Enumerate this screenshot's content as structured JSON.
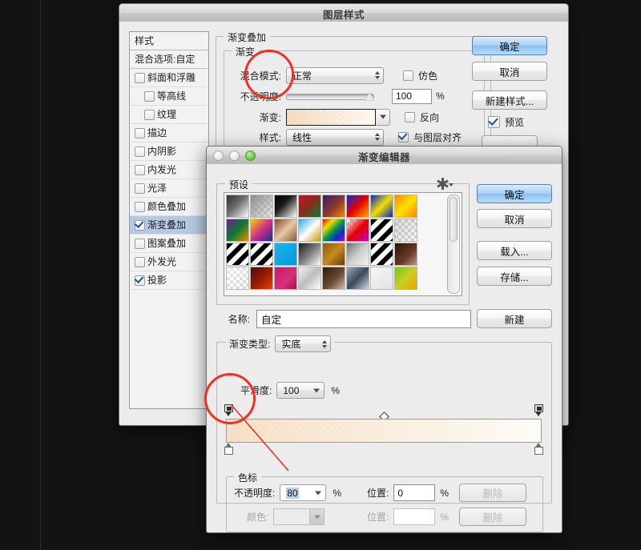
{
  "layer_style": {
    "title": "图层样式",
    "sidebar": {
      "header": "样式",
      "blending": "混合选项:自定",
      "items": [
        {
          "label": "斜面和浮雕",
          "checked": false,
          "sub": false,
          "selected": false
        },
        {
          "label": "等高线",
          "checked": false,
          "sub": true,
          "selected": false
        },
        {
          "label": "纹理",
          "checked": false,
          "sub": true,
          "selected": false
        },
        {
          "label": "描边",
          "checked": false,
          "sub": false,
          "selected": false
        },
        {
          "label": "内阴影",
          "checked": false,
          "sub": false,
          "selected": false
        },
        {
          "label": "内发光",
          "checked": false,
          "sub": false,
          "selected": false
        },
        {
          "label": "光泽",
          "checked": false,
          "sub": false,
          "selected": false
        },
        {
          "label": "颜色叠加",
          "checked": false,
          "sub": false,
          "selected": false
        },
        {
          "label": "渐变叠加",
          "checked": true,
          "sub": false,
          "selected": true
        },
        {
          "label": "图案叠加",
          "checked": false,
          "sub": false,
          "selected": false
        },
        {
          "label": "外发光",
          "checked": false,
          "sub": false,
          "selected": false
        },
        {
          "label": "投影",
          "checked": true,
          "sub": false,
          "selected": false
        }
      ]
    },
    "panel": {
      "group_title": "渐变叠加",
      "sub_group_title": "渐变",
      "blend_mode_label": "混合模式:",
      "blend_mode_value": "正常",
      "dither_label": "仿色",
      "dither_checked": false,
      "opacity_label": "不透明度:",
      "opacity_value": "100",
      "opacity_unit": "%",
      "gradient_label": "渐变:",
      "reverse_label": "反向",
      "reverse_checked": false,
      "style_label": "样式:",
      "style_value": "线性",
      "align_label": "与图层对齐",
      "align_checked": true
    },
    "buttons": {
      "ok": "确定",
      "cancel": "取消",
      "new_style": "新建样式...",
      "preview_label": "预览",
      "preview_checked": true
    }
  },
  "gradient_editor": {
    "title": "渐变编辑器",
    "presets": {
      "group_title": "预设",
      "swatches": [
        "linear-gradient(135deg,#2e2e2e 0%,#6d6d6d 45%,#ffffff 100%)",
        "linear-gradient(135deg,#8e8e8e 0%,rgba(200,200,200,0.35) 100%)",
        "linear-gradient(135deg,#000000 0%,#1a1a1a 40%,#ffffff 100%)",
        "linear-gradient(135deg,#c8102e 0%,#8a2b1e 45%,#0a7a33 100%)",
        "linear-gradient(135deg,#3b1a6e 0%,#8a3b2a 55%,#f58a00 100%)",
        "linear-gradient(135deg,#0a2bd0 0%,#e60000 50%,#f5b000 100%)",
        "linear-gradient(135deg,#0a1fc8 0%,#f2e000 50%,#0a1fc8 100%)",
        "linear-gradient(135deg,#f58a00 0%,#ffe000 50%,#f58a00 100%)",
        "linear-gradient(135deg,#6b1f8a 0%,#0a7a33 50%,#f58a00 100%)",
        "linear-gradient(135deg,#f5d000 0%,#d0308a 50%,#1a2b8a 100%)",
        "linear-gradient(135deg,#7a4a2a 0%,#e8c7a8 50%,#8a5a32 100%)",
        "linear-gradient(135deg,#2aa8e8 0%,#ffffff 50%,#c8960a 100%)",
        "linear-gradient(135deg,#e60000 0%,#f2e000 25%,#0a9a4a 50%,#0a2bd0 75%,#c000c0 100%)",
        "linear-gradient(135deg,rgba(255,255,255,0.25) 0%,#e60000 50%,#c000c0 100%)",
        "repeating-linear-gradient(135deg,#000 0 6px,#fff 6px 12px)",
        "linear-gradient(135deg,rgba(180,180,180,0.5),rgba(220,220,220,0.2))",
        "repeating-linear-gradient(135deg,#000 0 6px,#fff 6px 12px)",
        "repeating-linear-gradient(135deg,#000 0 6px,#fff 6px 12px)",
        "linear-gradient(135deg,#19b5f0 0%,#0a95d8 100%)",
        "linear-gradient(135deg,#1a1a1a 0%,#8a8a8a 55%,#ffffff 100%)",
        "linear-gradient(135deg,#8a5a0a 0%,#c88a20 50%,#6a3a08 100%)",
        "linear-gradient(135deg,#6f6f6f 0%,#cfcfcf 50%,#f2f2f2 100%)",
        "repeating-linear-gradient(135deg,#000 0 6px,#fff 6px 12px)",
        "linear-gradient(135deg,#2a1208 0%,#6a3a28 60%,#b89a88 100%)",
        "linear-gradient(135deg,rgba(255,255,255,0.6) 0%,rgba(230,230,230,0.2) 100%)",
        "linear-gradient(135deg,#4a0a0a 0%,#a82000 60%,#e04a10 100%)",
        "linear-gradient(135deg,#c01a6a 0%,#d8307a 60%,#a01050 100%)",
        "linear-gradient(135deg,#f2f2f2 0%,#bdbdbd 50%,#ffffff 100%)",
        "linear-gradient(135deg,#2a1a10 0%,#6a4a30 55%,#cbbfb2 100%)",
        "linear-gradient(135deg,#9aaabb 0%,#3a4a5a 50%,#cfd8e0 100%)",
        "linear-gradient(135deg,#f4f4f4 0%,#e4e4e4 100%)",
        "linear-gradient(135deg,#7ac020 0%,#c8d020 50%,#f0a000 100%)"
      ]
    },
    "buttons": {
      "ok": "确定",
      "cancel": "取消",
      "load": "载入...",
      "save": "存储...",
      "new": "新建"
    },
    "name_label": "名称:",
    "name_value": "自定",
    "type_group_title": "渐变类型:",
    "type_value": "实底",
    "smooth_label": "平滑度:",
    "smooth_value": "100",
    "smooth_unit": "%",
    "stops": {
      "group_title": "色标",
      "opacity_label": "不透明度:",
      "opacity_value": "80",
      "opacity_unit": "%",
      "position_label": "位置:",
      "position_value": "0",
      "position_unit": "%",
      "delete_label": "删除",
      "color_label": "颜色:",
      "position2_label": "位置:",
      "position2_value": "",
      "delete2_label": "删除"
    }
  },
  "annotations": {
    "accent_color": "#ef3124",
    "circle_blend_mode": "blend-mode dropdown highlighted",
    "circle_opacity_stop": "left opacity stop highlighted",
    "pointer_line": "stop to opacity field"
  }
}
